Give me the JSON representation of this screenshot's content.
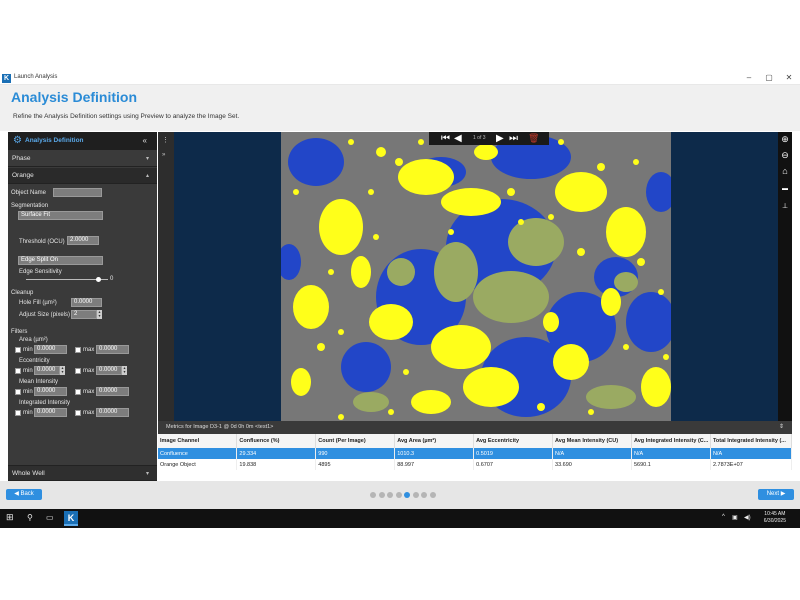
{
  "window": {
    "title": "Launch Analysis",
    "app_icon": "K"
  },
  "header": {
    "title": "Analysis Definition",
    "subtitle": "Refine the Analysis Definition settings using Preview to analyze the Image Set."
  },
  "left_panel": {
    "heading": "Analysis Definition",
    "sections": {
      "phase": "Phase",
      "orange": "Orange",
      "whole_well": "Whole Well"
    },
    "object_name_label": "Object Name",
    "object_name_value": "",
    "segmentation_label": "Segmentation",
    "segmentation_value": "Surface Fit",
    "threshold_label": "Threshold (OCU)",
    "threshold_value": "2.0000",
    "edge_split_value": "Edge Split On",
    "edge_sensitivity_label": "Edge Sensitivity",
    "edge_sensitivity_value": "0",
    "cleanup_label": "Cleanup",
    "hole_fill_label": "Hole Fill (µm²)",
    "hole_fill_value": "0.0000",
    "adjust_size_label": "Adjust Size (pixels)",
    "adjust_size_value": "2",
    "filters_label": "Filters",
    "min_label": "min",
    "max_label": "max",
    "filters": [
      {
        "name": "Area (µm²)",
        "min": "0.0000",
        "max": "0.0000"
      },
      {
        "name": "Eccentricity",
        "min": "0.0000",
        "max": "0.0000"
      },
      {
        "name": "Mean Intensity",
        "min": "0.0000",
        "max": "0.0000"
      },
      {
        "name": "Integrated Intensity",
        "min": "0.0000",
        "max": "0.0000"
      }
    ]
  },
  "viewer": {
    "pager": "1 of 3"
  },
  "metrics": {
    "title": "Metrics for Image D3-1 @ 0d 0h 0m <test1>",
    "columns": [
      "Image Channel",
      "Confluence (%)",
      "Count (Per Image)",
      "Avg Area (µm²)",
      "Avg Eccentricity",
      "Avg Mean Intensity (CU)",
      "Avg Integrated Intensity (C...",
      "Total Integrated Intensity (..."
    ],
    "rows": [
      [
        "Confluence",
        "29.334",
        "990",
        "1010.3",
        "0.5019",
        "N/A",
        "N/A",
        "N/A"
      ],
      [
        "Orange Object",
        "19.838",
        "4895",
        "88.997",
        "0.6707",
        "33.690",
        "5690.1",
        "2.7873E+07"
      ]
    ]
  },
  "nav": {
    "back": "Back",
    "next": "Next",
    "pages": 8,
    "active_page": 5
  },
  "taskbar": {
    "time": "10:45 AM",
    "date": "6/30/2025"
  },
  "colors": {
    "accent": "#2f8fe0",
    "title_blue": "#2a8bd6",
    "cells_blue": "#2246c8",
    "objects_yellow": "#ffff1a",
    "phase_green": "#9aaa62"
  }
}
